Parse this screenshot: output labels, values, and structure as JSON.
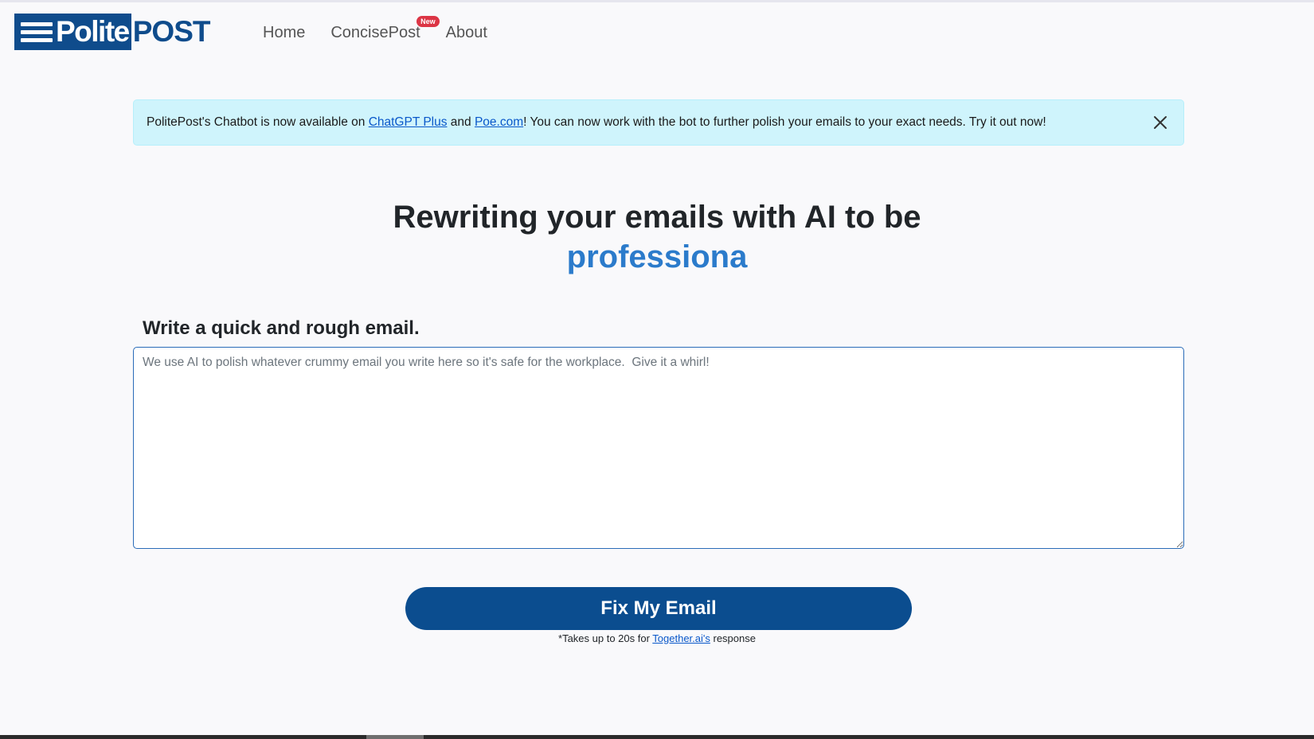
{
  "logo": {
    "part1": "Polite",
    "part2": "POST"
  },
  "nav": {
    "items": [
      {
        "label": "Home"
      },
      {
        "label": "ConcisePost",
        "badge": "New"
      },
      {
        "label": "About"
      }
    ]
  },
  "alert": {
    "text_before": "PolitePost's Chatbot is now available on ",
    "link1": "ChatGPT Plus",
    "text_mid": " and ",
    "link2": "Poe.com",
    "text_after": "! You can now work with the bot to further polish your emails to your exact needs. Try it out now!"
  },
  "hero": {
    "title": "Rewriting your emails with AI to be",
    "typed_word": "professiona"
  },
  "form": {
    "label": "Write a quick and rough email.",
    "placeholder": "We use AI to polish whatever crummy email you write here so it's safe for the workplace.  Give it a whirl!",
    "value": "",
    "button_label": "Fix My Email"
  },
  "note": {
    "before": "*Takes up to 20s for ",
    "link": "Together.ai's",
    "after": " response"
  },
  "colors": {
    "brand": "#0f4c8c",
    "accent": "#2b7bcb",
    "alert_bg": "#cff4fc",
    "badge": "#dc3545"
  }
}
